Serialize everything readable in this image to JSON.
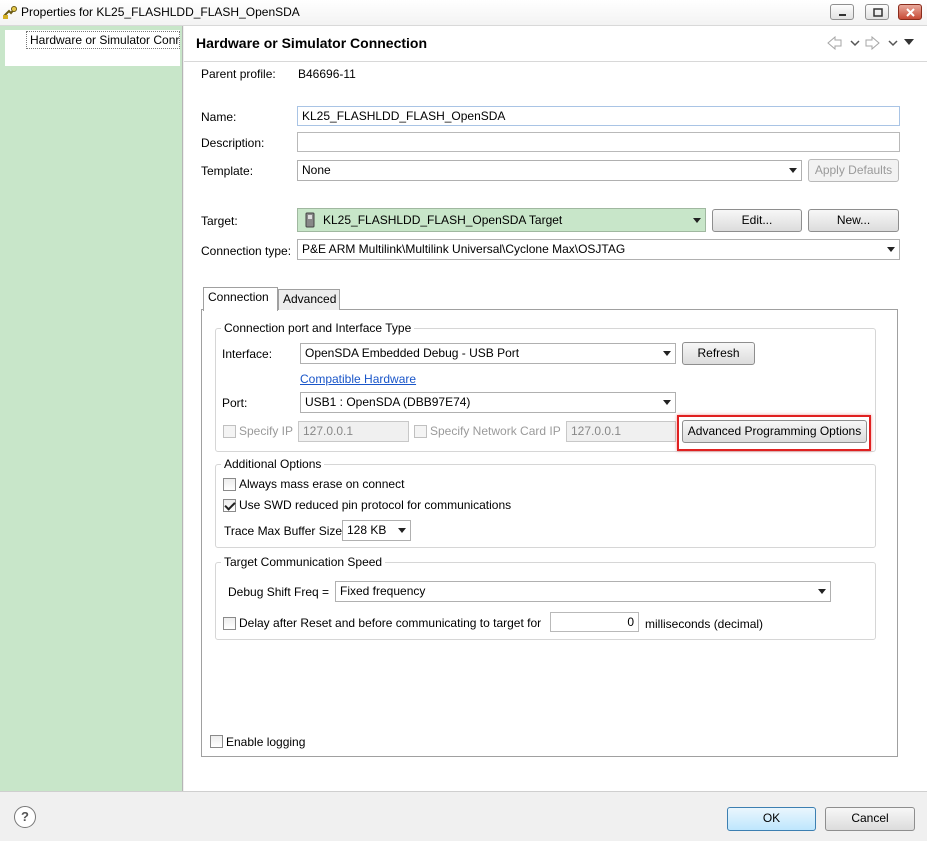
{
  "window": {
    "title": "Properties for KL25_FLASHLDD_FLASH_OpenSDA"
  },
  "nav": {
    "items": [
      {
        "label": "Hardware or Simulator Conr"
      }
    ]
  },
  "header": {
    "title": "Hardware or Simulator Connection"
  },
  "form": {
    "parent_profile_label": "Parent profile:",
    "parent_profile_value": "B46696-11",
    "name_label": "Name:",
    "name_value": "KL25_FLASHLDD_FLASH_OpenSDA",
    "description_label": "Description:",
    "description_value": "",
    "template_label": "Template:",
    "template_value": "None",
    "apply_defaults_label": "Apply Defaults",
    "target_label": "Target:",
    "target_value": "KL25_FLASHLDD_FLASH_OpenSDA Target",
    "edit_label": "Edit...",
    "new_label": "New...",
    "connection_type_label": "Connection type:",
    "connection_type_value": "P&E ARM Multilink\\Multilink Universal\\Cyclone Max\\OSJTAG"
  },
  "tabs": [
    {
      "label": "Connection",
      "active": true
    },
    {
      "label": "Advanced",
      "active": false
    }
  ],
  "connection": {
    "port_group_title": "Connection port and Interface Type",
    "interface_label": "Interface:",
    "interface_value": "OpenSDA Embedded Debug - USB Port",
    "refresh_label": "Refresh",
    "compatible_hardware_label": "Compatible Hardware",
    "port_label": "Port:",
    "port_value": "USB1 : OpenSDA (DBB97E74)",
    "specify_ip_label": "Specify IP",
    "ip_value": "127.0.0.1",
    "specify_nic_label": "Specify Network Card IP",
    "nic_ip_value": "127.0.0.1",
    "advanced_programming_label": "Advanced Programming Options",
    "additional_group_title": "Additional Options",
    "mass_erase_label": "Always mass erase on connect",
    "mass_erase_checked": false,
    "swd_label": "Use SWD reduced pin protocol for communications",
    "swd_checked": true,
    "trace_label": "Trace Max Buffer Size:",
    "trace_value": "128 KB",
    "speed_group_title": "Target Communication Speed",
    "debug_shift_label": "Debug Shift Freq =",
    "debug_shift_value": "Fixed frequency",
    "delay_label": "Delay after Reset and before communicating to target for",
    "delay_checked": false,
    "delay_value": "0",
    "delay_unit": "milliseconds (decimal)",
    "enable_logging_label": "Enable logging",
    "enable_logging_checked": false
  },
  "footer": {
    "ok_label": "OK",
    "cancel_label": "Cancel"
  },
  "colors": {
    "nav_bg": "#c8e6c9",
    "target_bg": "#c8e6c9",
    "highlight": "#e02020",
    "link": "#1a56c9"
  },
  "icons": {
    "app": "app-icon",
    "help": "help-icon",
    "target": "board-icon"
  }
}
